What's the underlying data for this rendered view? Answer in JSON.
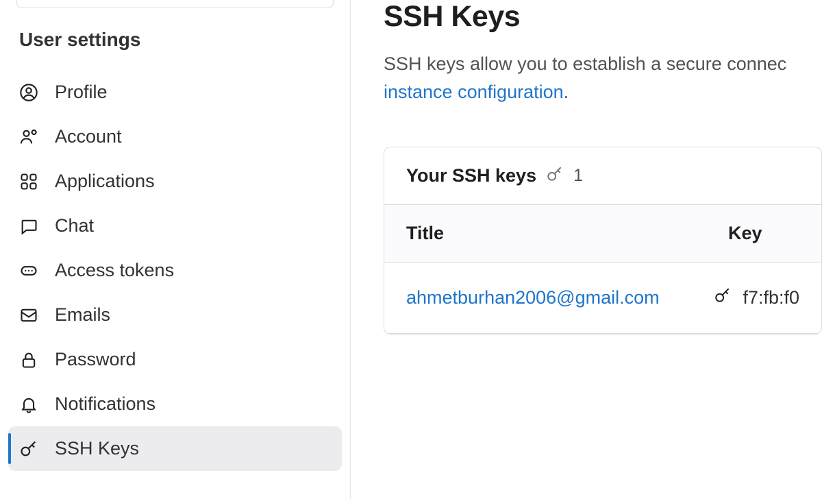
{
  "sidebar": {
    "heading": "User settings",
    "items": [
      {
        "label": "Profile",
        "icon": "profile-icon"
      },
      {
        "label": "Account",
        "icon": "account-icon"
      },
      {
        "label": "Applications",
        "icon": "applications-icon"
      },
      {
        "label": "Chat",
        "icon": "chat-icon"
      },
      {
        "label": "Access tokens",
        "icon": "token-icon"
      },
      {
        "label": "Emails",
        "icon": "email-icon"
      },
      {
        "label": "Password",
        "icon": "lock-icon"
      },
      {
        "label": "Notifications",
        "icon": "bell-icon"
      },
      {
        "label": "SSH Keys",
        "icon": "key-icon",
        "active": true
      }
    ]
  },
  "main": {
    "title": "SSH Keys",
    "description_prefix": "SSH keys allow you to establish a secure connec",
    "link_text": "instance configuration",
    "period": ".",
    "card": {
      "header_title": "Your SSH keys",
      "count": "1",
      "columns": {
        "title": "Title",
        "key": "Key"
      },
      "rows": [
        {
          "title": "ahmetburhan2006@gmail.com",
          "fingerprint": "f7:fb:f0"
        }
      ]
    }
  }
}
